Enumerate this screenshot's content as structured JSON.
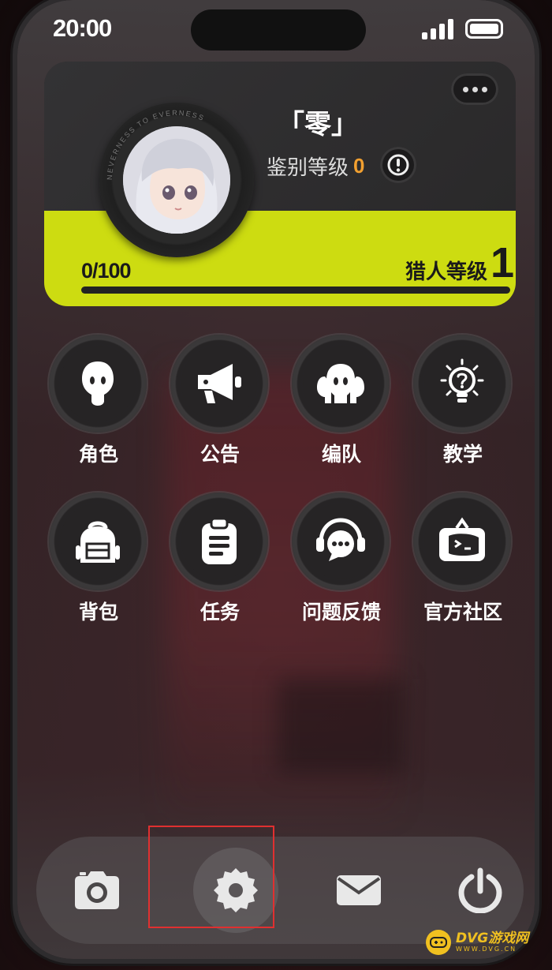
{
  "status_bar": {
    "time": "20:00"
  },
  "profile": {
    "name": "「零」",
    "rank_label": "鉴别等级",
    "rank_value": "0",
    "ring_text": "NEVERNESS TO EVERNESS",
    "exp_text": "0/100",
    "exp_progress": 0,
    "hunter_label": "猎人等级",
    "hunter_level": "1"
  },
  "menu": {
    "row1": [
      {
        "label": "角色",
        "icon": "character-icon"
      },
      {
        "label": "公告",
        "icon": "megaphone-icon"
      },
      {
        "label": "编队",
        "icon": "team-icon"
      },
      {
        "label": "教学",
        "icon": "lightbulb-icon"
      }
    ],
    "row2": [
      {
        "label": "背包",
        "icon": "backpack-icon"
      },
      {
        "label": "任务",
        "icon": "clipboard-icon"
      },
      {
        "label": "问题反馈",
        "icon": "feedback-icon"
      },
      {
        "label": "官方社区",
        "icon": "community-icon"
      }
    ]
  },
  "dock": [
    {
      "icon": "camera-icon"
    },
    {
      "icon": "settings-gear-icon",
      "selected": true
    },
    {
      "icon": "mail-icon"
    },
    {
      "icon": "power-icon"
    }
  ],
  "watermark": {
    "main": "DVG游戏网",
    "sub": "WWW.DVG.CN"
  }
}
